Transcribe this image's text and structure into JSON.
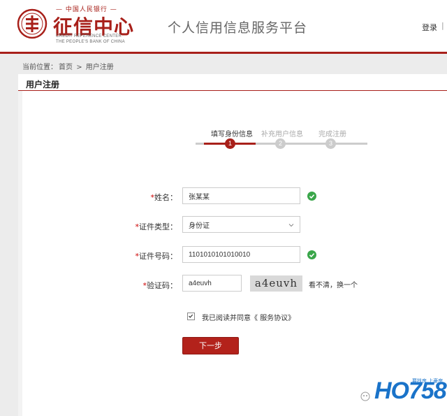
{
  "header": {
    "logo_top": "— 中国人民银行 —",
    "logo_main": "征信中心",
    "logo_en_line1": "CREDIT REFERENCE CENTER",
    "logo_en_line2": "THE PEOPLE'S BANK OF CHINA",
    "platform_title": "个人信用信息服务平台",
    "login": "登录",
    "login_sep": "|"
  },
  "breadcrumb": {
    "prefix": "当前位置：",
    "home": "首页",
    "sep": ">",
    "current": "用户注册"
  },
  "card": {
    "title": "用户注册"
  },
  "steps": [
    {
      "label": "填写身份信息",
      "num": "1",
      "active": true
    },
    {
      "label": "补充用户信息",
      "num": "2",
      "active": false
    },
    {
      "label": "完成注册",
      "num": "3",
      "active": false
    }
  ],
  "form": {
    "name_label": "姓名：",
    "name_value": "张某某",
    "id_type_label": "证件类型：",
    "id_type_value": "身份证",
    "id_number_label": "证件号码：",
    "id_number_value": "1101010101010010",
    "captcha_label": "验证码：",
    "captcha_value": "a4euvh",
    "captcha_image_text": "a4euvh",
    "captcha_refresh": "看不清，换一个",
    "required_mark": "*"
  },
  "agreement": {
    "text": "我已阅读并同意《",
    "link": "服务协议",
    "end": "》"
  },
  "next_button": "下一步",
  "watermark": {
    "logo": "HO758",
    "sub": "要找房 上豪房"
  },
  "colors": {
    "brand_red": "#a8201a",
    "success_green": "#3aa64a",
    "watermark_blue": "#1a73c9"
  }
}
